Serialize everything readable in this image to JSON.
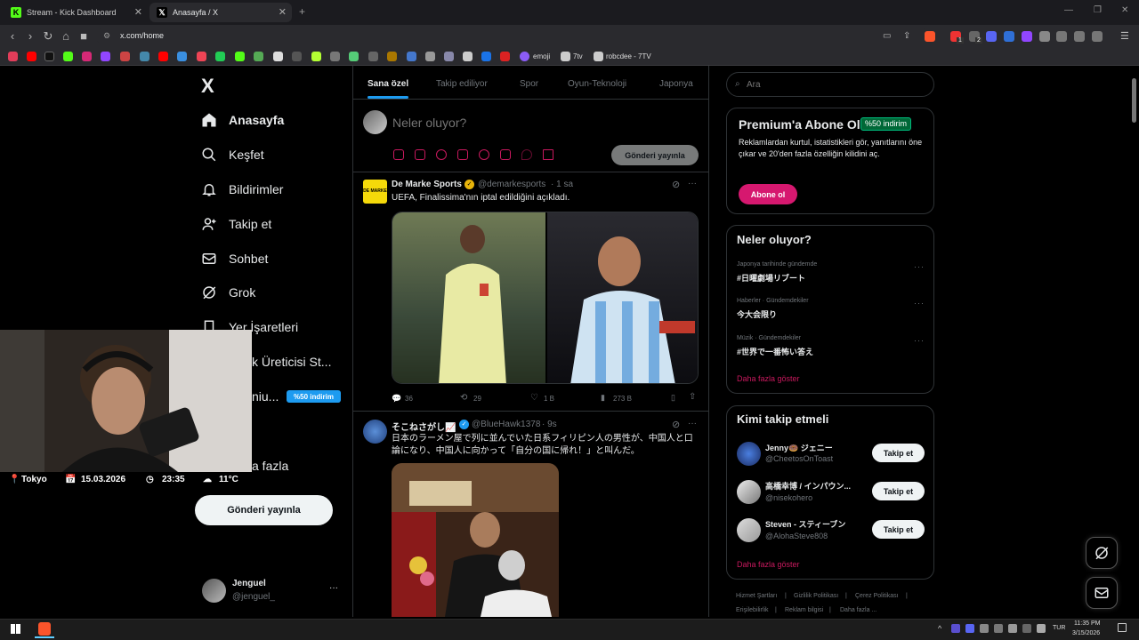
{
  "browser": {
    "tabs": [
      {
        "title": "Stream - Kick Dashboard",
        "active": false
      },
      {
        "title": "Anasayfa / X",
        "active": true
      }
    ],
    "url": "x.com/home",
    "bookmarks": [
      "emoji",
      "7tv",
      "robcdee - 7TV"
    ],
    "ext_badges": [
      "1",
      "2"
    ]
  },
  "sidebar": {
    "logo": "X",
    "items": [
      {
        "label": "Anasayfa",
        "icon": "home-icon",
        "active": true
      },
      {
        "label": "Keşfet",
        "icon": "search-icon"
      },
      {
        "label": "Bildirimler",
        "icon": "bell-icon"
      },
      {
        "label": "Takip et",
        "icon": "follow-icon"
      },
      {
        "label": "Sohbet",
        "icon": "mail-icon"
      },
      {
        "label": "Grok",
        "icon": "grok-icon"
      },
      {
        "label": "Yer İşaretleri",
        "icon": "bookmark-icon"
      },
      {
        "label": "k Üreticisi St...",
        "icon": "creator-icon"
      },
      {
        "label": "niu...",
        "icon": "premium-icon"
      },
      {
        "label": "a fazla",
        "icon": "more-icon"
      }
    ],
    "premium_badge": "%50 indirim",
    "post_button": "Gönderi yayınla",
    "account": {
      "name": "Jenguel",
      "handle": "@jenguel_",
      "more": "···"
    }
  },
  "feed": {
    "tabs": [
      "Sana özel",
      "Takip ediliyor",
      "Spor",
      "Oyun-Teknoloji",
      "Japonya"
    ],
    "composer": {
      "placeholder": "Neler oluyor?",
      "post_button": "Gönderi yayınla"
    },
    "posts": [
      {
        "author": "De Marke Sports",
        "verified": true,
        "handle": "@demarkesports",
        "time": "· 1 sa",
        "text": "UEFA, Finalissima'nın iptal edildiğini açıkladı.",
        "replies": "36",
        "reposts": "29",
        "likes": "1 B",
        "views": "273 B",
        "image_text": "DE MARKE"
      },
      {
        "author": "そこねさがし📈",
        "verified": true,
        "handle": "@BlueHawk1378",
        "time": "· 9s",
        "text": "日本のラーメン屋で列に並んでいた日系フィリピン人の男性が、中国人と口論になり、中国人に向かって「自分の国に帰れ！」と叫んだ。"
      }
    ]
  },
  "right": {
    "search_placeholder": "Ara",
    "premium": {
      "title": "Premium'a Abone Ol",
      "badge": "%50 indirim",
      "text": "Reklamlardan kurtul, istatistikleri gör, yanıtlarını öne çıkar ve 20'den fazla özelliğin kilidini aç.",
      "button": "Abone ol"
    },
    "trends": {
      "title": "Neler oluyor?",
      "items": [
        {
          "meta": "Japonya tarihinde gündemde",
          "name": "#日曜劇場リブート"
        },
        {
          "meta": "Haberler · Gündemdekiler",
          "name": "今大会限り"
        },
        {
          "meta": "Müzik · Gündemdekiler",
          "name": "#世界で一番怖い答え"
        }
      ],
      "more": "Daha fazla göster"
    },
    "who_to_follow": {
      "title": "Kimi takip etmeli",
      "users": [
        {
          "name": "Jenny🍩 ジェニー",
          "handle": "@CheetosOnToast",
          "button": "Takip et"
        },
        {
          "name": "高橋幸博 / インパウン...",
          "handle": "@nisekohero",
          "button": "Takip et"
        },
        {
          "name": "Steven - スティーブン",
          "handle": "@AlohaSteve808",
          "button": "Takip et"
        }
      ],
      "more": "Daha fazla göster"
    },
    "footer": [
      "Hizmet Şartları",
      "|",
      "Gizlilik Politikası",
      "|",
      "Çerez Politikası",
      "|",
      "Erişilebilirlik",
      "|",
      "Reklam bilgisi",
      "|",
      "Daha fazla ..."
    ]
  },
  "webcam_overlay": {
    "city": "Tokyo",
    "date": "15.03.2026",
    "time": "23:35",
    "temp": "11°C"
  },
  "taskbar": {
    "lang": "TUR",
    "time": "11:35 PM",
    "date": "3/15/2026"
  },
  "colors": {
    "accent": "#1d9bf0",
    "pink": "#f91880",
    "premium_green": "#00ba7c"
  }
}
